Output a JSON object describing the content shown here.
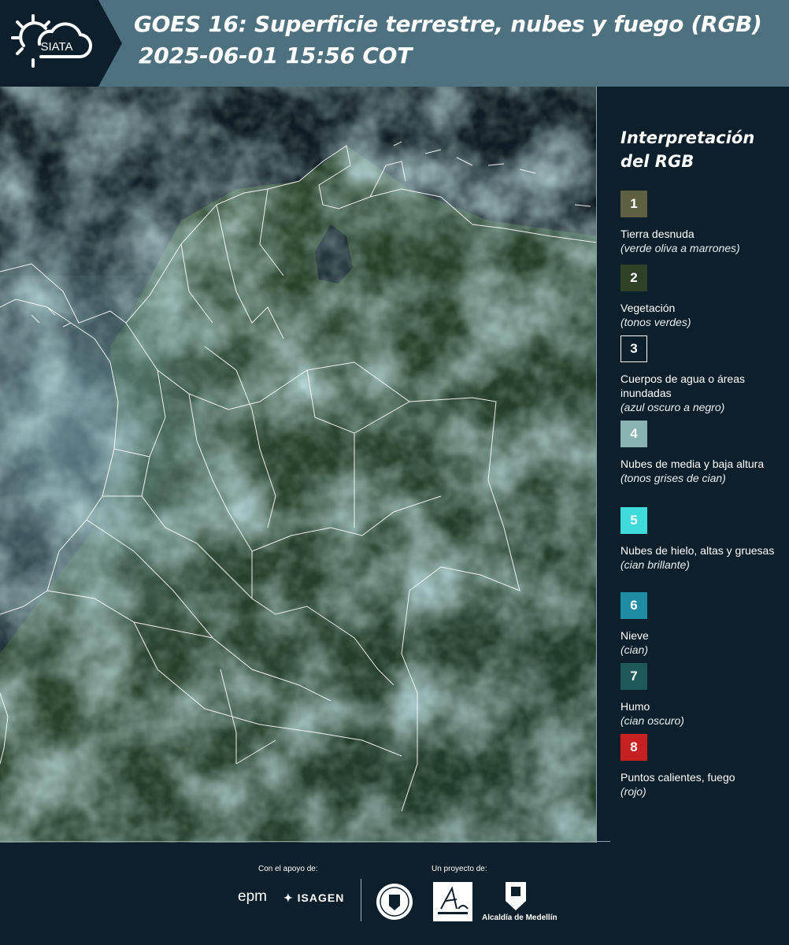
{
  "header": {
    "logo_text": "SIATA",
    "title_line1": "GOES 16: Superficie terrestre, nubes y fuego (RGB)",
    "title_line2": "2025-06-01 15:56 COT",
    "band_color": "#4e7180",
    "logo_bg": "#0d1f2b"
  },
  "legend": {
    "title": "Interpretación del RGB",
    "items": [
      {
        "number": "1",
        "label": "Tierra desnuda",
        "note": "(verde oliva a marrones)",
        "color": "#5f5f42"
      },
      {
        "number": "2",
        "label": "Vegetación",
        "note": "(tonos verdes)",
        "color": "#2e4124"
      },
      {
        "number": "3",
        "label": "Cuerpos de agua o áreas inundadas",
        "note": "(azul oscuro a negro)",
        "color": "#0d1f2b"
      },
      {
        "number": "4",
        "label": "Nubes de media y baja altura",
        "note": "(tonos grises de cian)",
        "color": "#8bb2b3"
      },
      {
        "number": "5",
        "label": "Nubes de hielo, altas y gruesas",
        "note": "(cian brillante)",
        "color": "#3fdada"
      },
      {
        "number": "6",
        "label": "Nieve",
        "note": "(cian)",
        "color": "#1f8ca3"
      },
      {
        "number": "7",
        "label": "Humo",
        "note": "(cian oscuro)",
        "color": "#1f5859"
      },
      {
        "number": "8",
        "label": "Puntos calientes, fuego",
        "note": "(rojo)",
        "color": "#c62020"
      }
    ]
  },
  "footer": {
    "support_caption": "Con el apoyo de:",
    "project_caption": "Un proyecto de:",
    "epm_logo": "epm",
    "isagen_logo": "ISAGEN",
    "alcaldia_text": "Alcaldía de Medellín"
  }
}
